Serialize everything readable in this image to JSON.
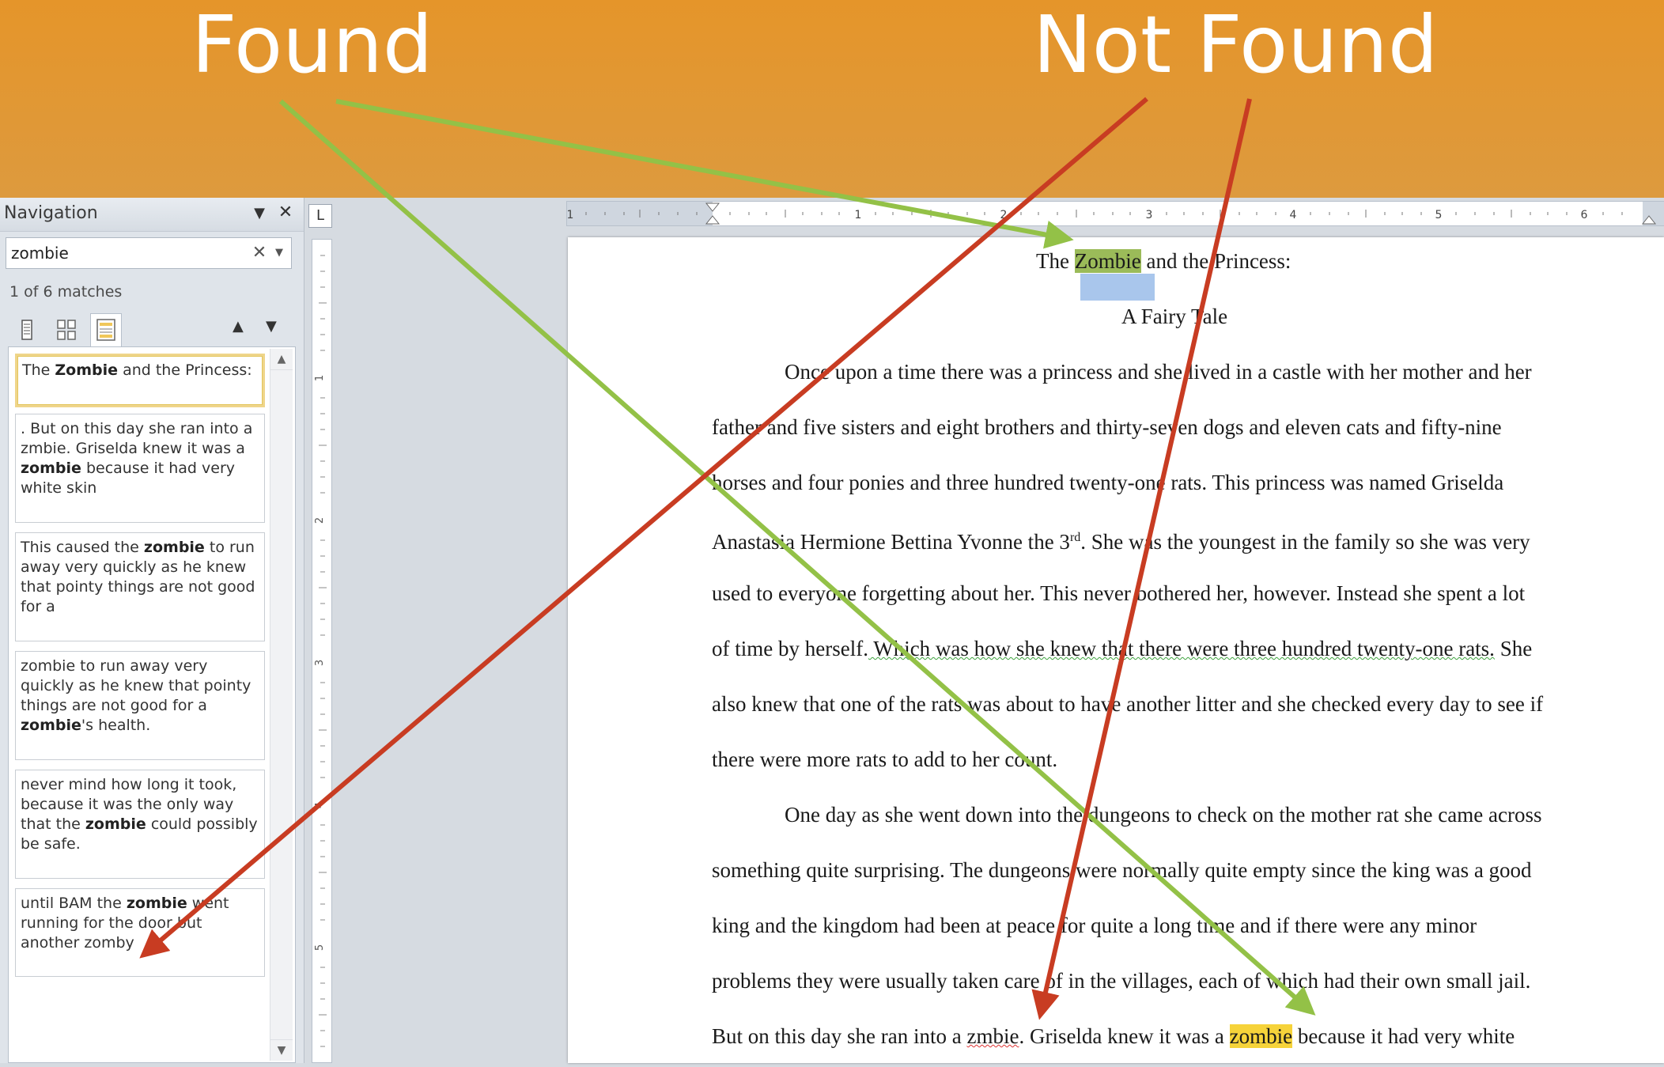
{
  "banner": {
    "found": "Found",
    "not_found": "Not Found"
  },
  "navigation": {
    "title": "Navigation",
    "menu_icon": "chevron-down-icon",
    "close_icon": "close-icon",
    "search_value": "zombie",
    "match_count": "1 of 6 matches",
    "tabs": [
      "browse-headings-icon",
      "browse-pages-icon",
      "browse-results-icon"
    ],
    "results": [
      {
        "before": "The ",
        "bold": "Zombie",
        "after": " and the Princess:"
      },
      {
        "before": ". But on this day she ran into a zmbie. Griselda knew it was a ",
        "bold": "zombie",
        "after": " because it had very white skin"
      },
      {
        "before": "This caused the ",
        "bold": "zombie",
        "after": " to run away very quickly as he knew that pointy things are not good for a"
      },
      {
        "before": "zombie to run away very quickly as he knew that pointy things are not good for a ",
        "bold": "zombie",
        "after": "'s health."
      },
      {
        "before": "never mind how long it took, because it was the only way that the ",
        "bold": "zombie",
        "after": " could possibly be safe."
      },
      {
        "before": "until BAM the ",
        "bold": "zombie",
        "after": " went running for the door but another zomby"
      }
    ]
  },
  "ruler": {
    "horizontal_numbers": [
      "1",
      "1",
      "2",
      "3",
      "4",
      "5",
      "6"
    ],
    "vertical_numbers": [
      "1",
      "2",
      "3",
      "4",
      "5"
    ]
  },
  "document": {
    "title_pre": "The ",
    "title_hl": "Zombie",
    "title_post": " and the Princess:",
    "subtitle": "A Fairy Tale",
    "lines": [
      "Once upon a time there was a princess  and she lived in a castle with her mother and her",
      "father and five sisters and eight brothers and thirty-seven dogs and eleven cats and fifty-nine",
      "horses and four ponies and three hundred twenty-one rats. This  princess  was named Griselda",
      "Anastasia Hermione Bettina Yvonne the 3",
      "used to everyone forgetting about her.  This never bothered her, however. Instead she spent a lot",
      "of time by herself.",
      "also knew that one of the rats was about to have another litter and she checked every day to see if",
      "there were more rats to add to her count.",
      "One day as she went down into the dungeons to check on the mother rat she came across",
      "something quite surprising.  The dungeons were normally quite empty since the king was a good",
      "king and the kingdom had been at peace for quite a long time and if there were any minor",
      "problems  they were usually taken care of in the villages,  each of which had their own small jail."
    ],
    "sup": "rd",
    "line4_tail": ". She was the youngest in the family so she was very",
    "line6_tail": " Which was how she knew that there were three hundred twenty-one rats.",
    "line6_end": " She",
    "last_pre": "But on this day she ran into a ",
    "last_typo": "zmbie",
    "last_mid": ". Griselda knew it was a ",
    "last_hl": "zombie",
    "last_post": " because it had very white"
  },
  "colors": {
    "banner": "#e5952a",
    "green_arrow": "#93c147",
    "red_arrow": "#c83c22",
    "found_highlight": "#9bbb59",
    "match_highlight": "#f6d33a"
  }
}
